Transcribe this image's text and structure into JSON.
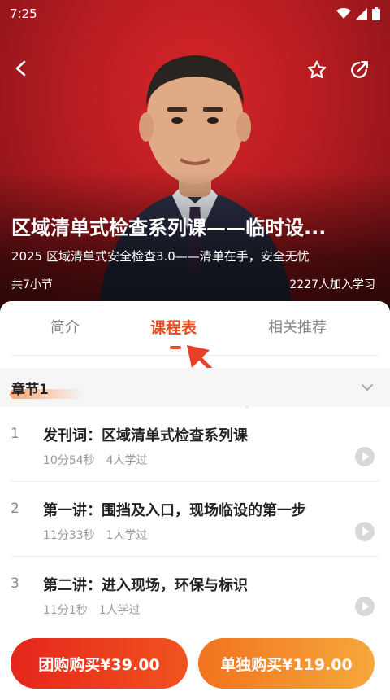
{
  "status_bar": {
    "time": "7:25"
  },
  "course": {
    "title": "区域清单式检查系列课——临时设...",
    "subtitle": "2025 区域清单式安全检查3.0——清单在手，安全无忧",
    "lessons_count": "共7小节",
    "learners": "2227人加入学习"
  },
  "tabs": [
    {
      "label": "简介"
    },
    {
      "label": "课程表"
    },
    {
      "label": "相关推荐"
    }
  ],
  "active_tab": "课程表",
  "chapter": {
    "title": "章节1"
  },
  "lessons": [
    {
      "num": "1",
      "title": "发刊词：区域清单式检查系列课",
      "duration": "10分54秒",
      "learned": "4人学过"
    },
    {
      "num": "2",
      "title": "第一讲：围挡及入口，现场临设的第一步",
      "duration": "11分33秒",
      "learned": "1人学过"
    },
    {
      "num": "3",
      "title": "第二讲：进入现场，环保与标识",
      "duration": "11分1秒",
      "learned": "1人学过"
    }
  ],
  "buttons": {
    "group_buy": "团购购买¥39.00",
    "single_buy": "单独购买¥119.00"
  },
  "colors": {
    "accent": "#e8491d",
    "hero_red": "#c5202a",
    "group_button": "#e5261b",
    "single_button": "#f39a30"
  },
  "icons": [
    "back-icon",
    "star-icon",
    "share-icon",
    "wifi-icon",
    "signal-icon",
    "battery-icon",
    "chevron-down-icon",
    "play-icon"
  ]
}
